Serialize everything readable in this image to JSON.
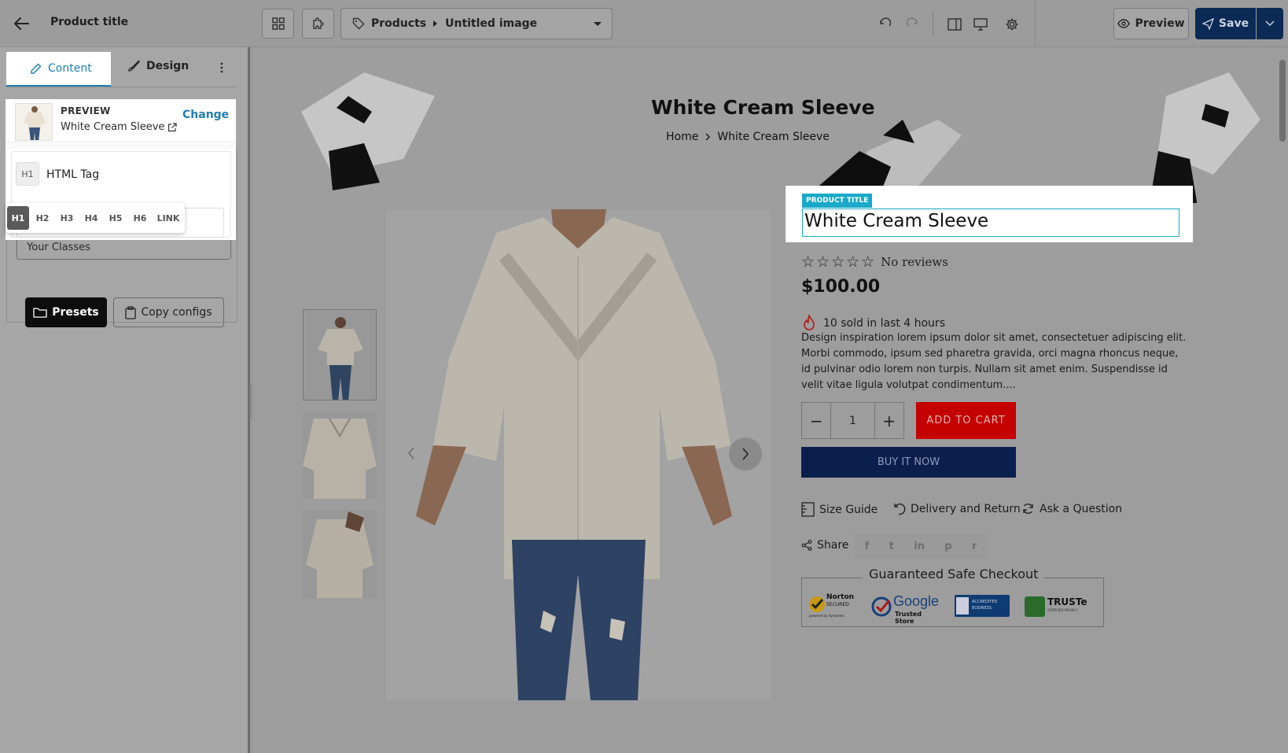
{
  "topbar": {
    "page_title": "Product title",
    "breadcrumb_root": "Products",
    "breadcrumb_current": "Untitled image",
    "preview_label": "Preview",
    "save_label": "Save"
  },
  "sidebar": {
    "tabs": [
      {
        "label": "Content"
      },
      {
        "label": "Design"
      }
    ],
    "preview_card": {
      "heading": "PREVIEW",
      "product_name": "White Cream Sleeve",
      "change_label": "Change"
    },
    "html_tag": {
      "badge": "H1",
      "label": "HTML Tag",
      "options": [
        "H1",
        "H2",
        "H3",
        "H4",
        "H5",
        "H6",
        "LINK"
      ],
      "selected": "H1"
    },
    "classes_placeholder": "Your Classes",
    "presets_label": "Presets",
    "copy_configs_label": "Copy configs"
  },
  "banner": {
    "title": "White Cream Sleeve",
    "crumb_home": "Home",
    "crumb_current": "White Cream Sleeve"
  },
  "product": {
    "badge": "PRODUCT TITLE",
    "title": "White Cream Sleeve",
    "reviews": "No reviews",
    "rating": 0,
    "price": "$100.00",
    "sold_text": "10 sold in last 4 hours",
    "description": "Design inspiration lorem ipsum dolor sit amet, consectetuer adipiscing elit. Morbi commodo, ipsum sed pharetra gravida, orci magna rhoncus neque, id pulvinar odio lorem non turpis. Nullam sit amet enim. Suspendisse id velit vitae ligula volutpat condimentum....",
    "quantity": "1",
    "add_to_cart": "ADD TO CART",
    "buy_now": "BUY IT NOW",
    "links": [
      "Size Guide",
      "Delivery and Return",
      "Ask a Question"
    ],
    "share_label": "Share",
    "trust_title": "Guaranteed Safe Checkout",
    "trust_badges": [
      {
        "name": "norton-secured",
        "line1": "Norton",
        "line2": "SECURED",
        "line3": "powered by Symantec"
      },
      {
        "name": "google-trusted-store",
        "line1": "Google",
        "line2": "Trusted Store"
      },
      {
        "name": "bbb-accredited",
        "line1": "ACCREDITED",
        "line2": "BUSINESS"
      },
      {
        "name": "truste",
        "line1": "TRUSTe",
        "line2": "CERTIFIED PRIVACY"
      }
    ]
  },
  "colors": {
    "accent_teal": "#1e7fb0",
    "add_to_cart": "#c40000",
    "buy_now": "#0a1f4d",
    "save_button": "#0b2a55",
    "badge": "#1ba9c9"
  }
}
